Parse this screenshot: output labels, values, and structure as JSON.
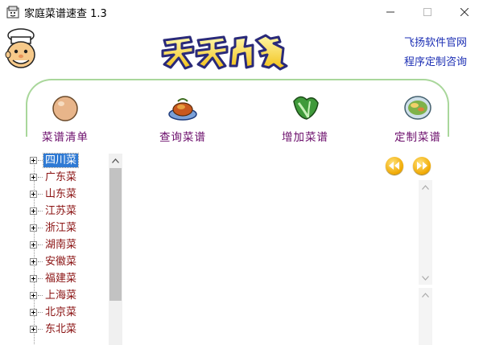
{
  "window": {
    "title": "家庭菜谱速查 1.3",
    "minimize_icon": "minimize-icon",
    "maximize_icon": "maximize-icon",
    "close_icon": "close-icon"
  },
  "header": {
    "logo_icon": "tiantian-yinshi-logo",
    "mascot_icon": "chef-mascot-icon",
    "link_official": "飞扬软件官网",
    "link_custom": "程序定制咨询"
  },
  "toolbar": {
    "items": [
      {
        "label": "菜谱清单",
        "icon": "egg-icon"
      },
      {
        "label": "查询菜谱",
        "icon": "dish-icon"
      },
      {
        "label": "增加菜谱",
        "icon": "cabbage-icon"
      },
      {
        "label": "定制菜谱",
        "icon": "bowl-icon"
      }
    ]
  },
  "tree": {
    "items": [
      {
        "label": "四川菜",
        "selected": true
      },
      {
        "label": "广东菜"
      },
      {
        "label": "山东菜"
      },
      {
        "label": "江苏菜"
      },
      {
        "label": "浙江菜"
      },
      {
        "label": "湖南菜"
      },
      {
        "label": "安徽菜"
      },
      {
        "label": "福建菜"
      },
      {
        "label": "上海菜"
      },
      {
        "label": "北京菜"
      },
      {
        "label": "东北菜"
      }
    ]
  },
  "colors": {
    "link": "#1c2fb4",
    "toolbar_label": "#6b0d6b",
    "tree_text": "#8a1212",
    "selection": "#2f7ad4",
    "arc_border": "#a9d79b"
  }
}
